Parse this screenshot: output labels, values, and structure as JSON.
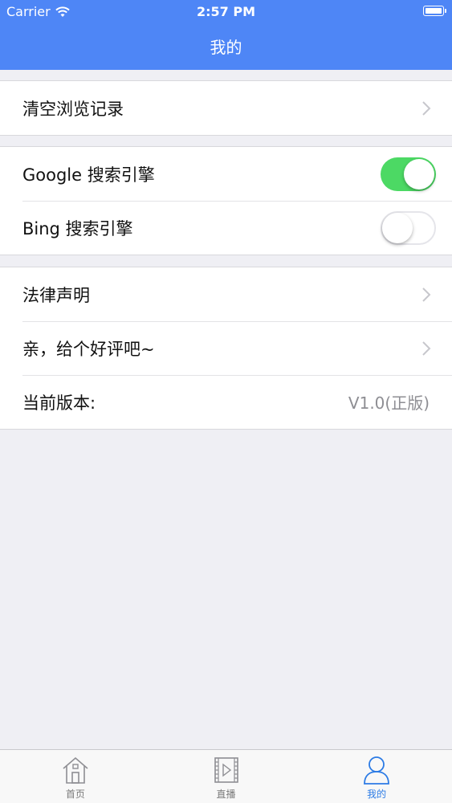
{
  "status_bar": {
    "carrier": "Carrier",
    "time": "2:57 PM"
  },
  "nav": {
    "title": "我的"
  },
  "groups": {
    "history": {
      "clear_label": "清空浏览记录"
    },
    "search": {
      "google_label": "Google 搜索引擎",
      "google_enabled": true,
      "bing_label": "Bing 搜索引擎",
      "bing_enabled": false
    },
    "about": {
      "legal_label": "法律声明",
      "rate_label": "亲，给个好评吧~",
      "version_label": "当前版本:",
      "version_value": "V1.0(正版)"
    }
  },
  "tabbar": {
    "home_label": "首页",
    "live_label": "直播",
    "mine_label": "我的",
    "active": "mine"
  },
  "colors": {
    "nav_bg": "#4e86f6",
    "switch_on": "#4cd964",
    "tab_active": "#2c7be5"
  }
}
